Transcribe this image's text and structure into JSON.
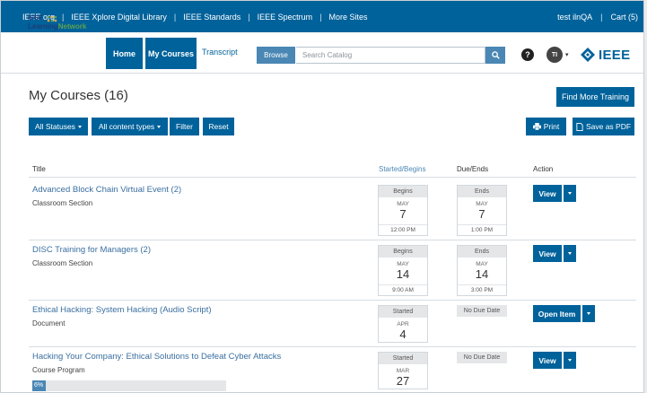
{
  "topbar": {
    "links": [
      "IEEE.org",
      "IEEE Xplore Digital Library",
      "IEEE Standards",
      "IEEE Spectrum",
      "More Sites"
    ],
    "user": "test ilnQA",
    "cart": "Cart (5)"
  },
  "header": {
    "logo_line1": "IEEE",
    "logo_line2a": "Learning",
    "logo_line2b": "Network",
    "nav": {
      "home": "Home",
      "my_courses": "My Courses",
      "transcript": "Transcript"
    },
    "browse": "Browse",
    "search_placeholder": "Search Catalog",
    "help": "?",
    "avatar_initials": "TI",
    "ieee": "IEEE"
  },
  "page": {
    "title": "My Courses (16)",
    "find_more": "Find More Training",
    "filters": {
      "statuses": "All Statuses",
      "content_types": "All content types",
      "filter": "Filter",
      "reset": "Reset"
    },
    "print": "Print",
    "save_pdf": "Save as PDF"
  },
  "table": {
    "columns": {
      "title": "Title",
      "started": "Started/Begins",
      "due": "Due/Ends",
      "action": "Action"
    },
    "rows": [
      {
        "title": "Advanced Block Chain Virtual Event (2)",
        "type": "Classroom Section",
        "start": {
          "label": "Begins",
          "month": "MAY",
          "day": "7",
          "time": "12:00 PM"
        },
        "end": {
          "label": "Ends",
          "month": "MAY",
          "day": "7",
          "time": "1:00 PM"
        },
        "action": "View"
      },
      {
        "title": "DISC Training for Managers (2)",
        "type": "Classroom Section",
        "start": {
          "label": "Begins",
          "month": "MAY",
          "day": "14",
          "time": "9:00 AM"
        },
        "end": {
          "label": "Ends",
          "month": "MAY",
          "day": "14",
          "time": "3:00 PM"
        },
        "action": "View"
      },
      {
        "title": "Ethical Hacking: System Hacking (Audio Script)",
        "type": "Document",
        "start": {
          "label": "Started",
          "month": "APR",
          "day": "4"
        },
        "end": {
          "label": "No Due Date"
        },
        "action": "Open Item"
      },
      {
        "title": "Hacking Your Company: Ethical Solutions to Defeat Cyber Attacks",
        "type": "Course Program",
        "start": {
          "label": "Started",
          "month": "MAR",
          "day": "27"
        },
        "end": {
          "label": "No Due Date"
        },
        "action": "View",
        "progress_label": "6%",
        "progress_value": 6
      }
    ]
  },
  "colors": {
    "primary": "#00629b",
    "link": "#3a6fa0",
    "accent": "#4a87b4"
  }
}
